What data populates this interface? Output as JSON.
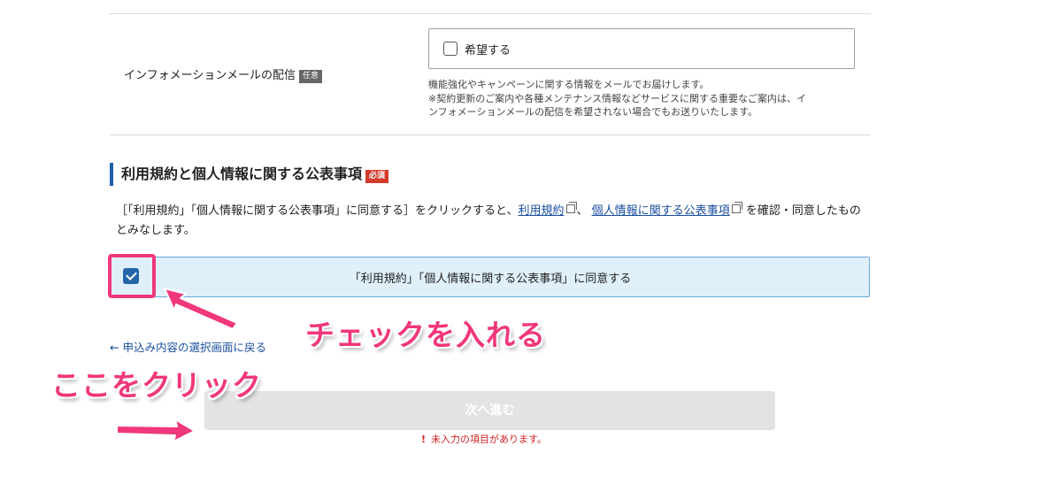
{
  "info_mail": {
    "label": "インフォメーションメールの配信",
    "optional_tag": "任意",
    "checkbox_label": "希望する",
    "checked": false,
    "note_lines": [
      "機能強化やキャンペーンに関する情報をメールでお届けします。",
      "※契約更新のご案内や各種メンテナンス情報などサービスに関する重要なご案内は、イ",
      "ンフォメーションメールの配信を希望されない場合でもお送りいたします。"
    ]
  },
  "terms": {
    "title": "利用規約と個人情報に関する公表事項",
    "required_tag": "必須",
    "desc_before": "［「利用規約」「個人情報に関する公表事項」に同意する］をクリックすると、",
    "link_terms": "利用規約",
    "desc_sep": "、",
    "link_privacy": "個人情報に関する公表事項",
    "desc_after": "を確認・同意したものとみなします。",
    "agree_label": "「利用規約」「個人情報に関する公表事項」に同意する",
    "agree_checked": true
  },
  "nav": {
    "back_label": "← 申込み内容の選択画面に戻る",
    "next_label": "次へ進む",
    "error_icon": "!",
    "error_message": "未入力の項目があります。"
  },
  "annotations": {
    "check_text": "チェックを入れる",
    "click_text": "ここをクリック",
    "color": "#f0377b"
  },
  "colors": {
    "accent_blue": "#1d5ea8",
    "link_blue": "#1a4fa0",
    "agree_bg": "#dff0fb",
    "error_red": "#d21f1f",
    "required_red": "#d23b2c"
  }
}
